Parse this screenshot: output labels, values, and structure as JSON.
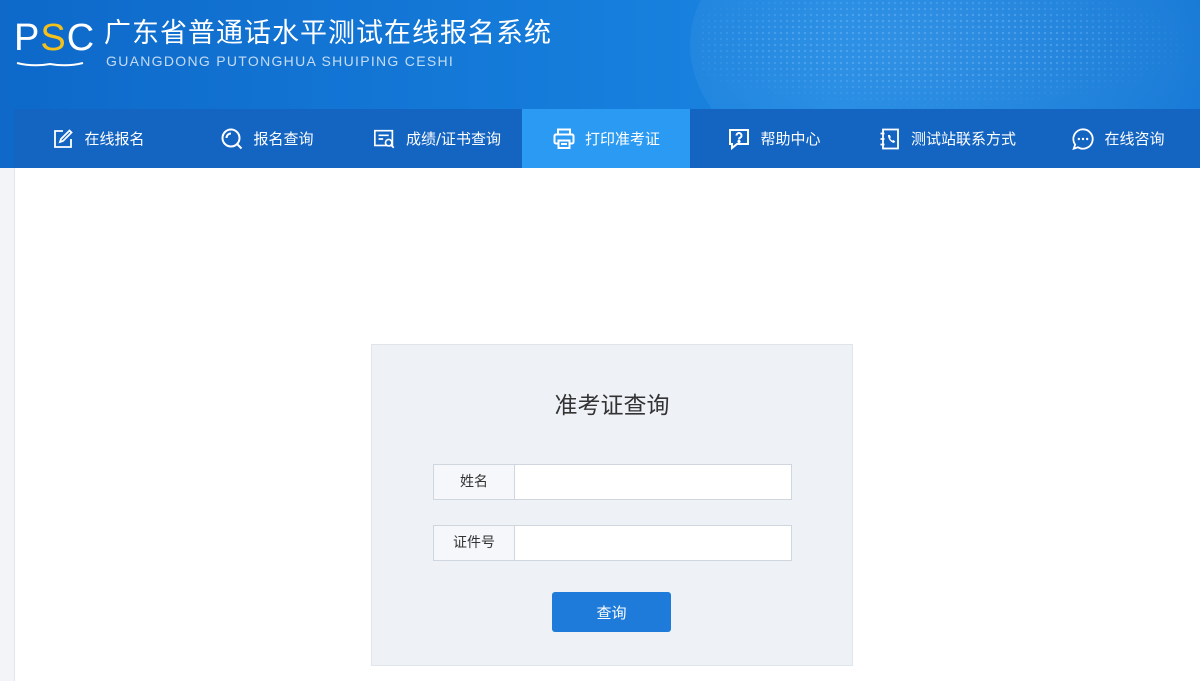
{
  "header": {
    "logo_letters_p": "P",
    "logo_letters_s": "S",
    "logo_letters_c": "C",
    "title": "广东省普通话水平测试在线报名系统",
    "subtitle": "GUANGDONG PUTONGHUA SHUIPING CESHI"
  },
  "nav": {
    "items": [
      {
        "label": "在线报名",
        "icon": "edit-icon"
      },
      {
        "label": "报名查询",
        "icon": "search-circle-icon"
      },
      {
        "label": "成绩/证书查询",
        "icon": "certificate-search-icon"
      },
      {
        "label": "打印准考证",
        "icon": "printer-icon",
        "active": true
      },
      {
        "label": "帮助中心",
        "icon": "help-icon"
      },
      {
        "label": "测试站联系方式",
        "icon": "phone-book-icon"
      },
      {
        "label": "在线咨询",
        "icon": "chat-icon"
      }
    ]
  },
  "form": {
    "title": "准考证查询",
    "name_label": "姓名",
    "name_value": "",
    "id_label": "证件号",
    "id_value": "",
    "submit_label": "查询"
  },
  "colors": {
    "header_bg": "#1479d8",
    "nav_bg": "#1464c2",
    "nav_active": "#2b9af3",
    "logo_accent": "#f4c11a",
    "button_bg": "#1e7bd9",
    "panel_bg": "#eef2f7"
  }
}
